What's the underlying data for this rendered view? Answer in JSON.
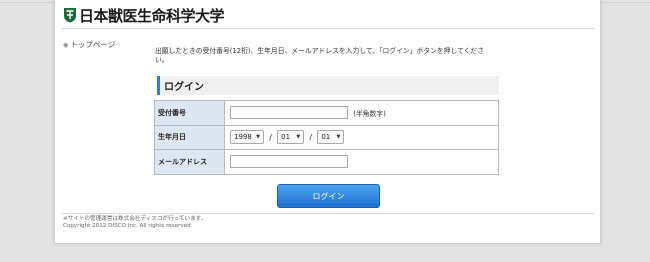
{
  "header": {
    "university_name": "日本獣医生命科学大学",
    "brand_color": "#1e6b3a"
  },
  "side_nav": {
    "home_link": "トップページ",
    "icon": "arrow-right-icon"
  },
  "intro_text": "出願したときの受付番号(12桁)、生年月日、メールアドレスを入力して、「ログイン」ボタンを押してください。",
  "login_section": {
    "title": "ログイン",
    "accent_color": "#2a7fd0"
  },
  "form": {
    "receipt_number": {
      "label": "受付番号",
      "value": "",
      "hint": "(半角数字)"
    },
    "birth_date": {
      "label": "生年月日",
      "year": "1998",
      "month": "01",
      "day": "01",
      "separator": "/"
    },
    "email": {
      "label": "メールアドレス",
      "value": ""
    }
  },
  "login_button": {
    "label": "ログイン",
    "color": "#1d6fd1"
  },
  "footer": {
    "note": "※サイトの管理運営は株式会社ディスコが行っています。",
    "copyright": "Copyright 2012 DISCO Inc. All rights reserved."
  }
}
